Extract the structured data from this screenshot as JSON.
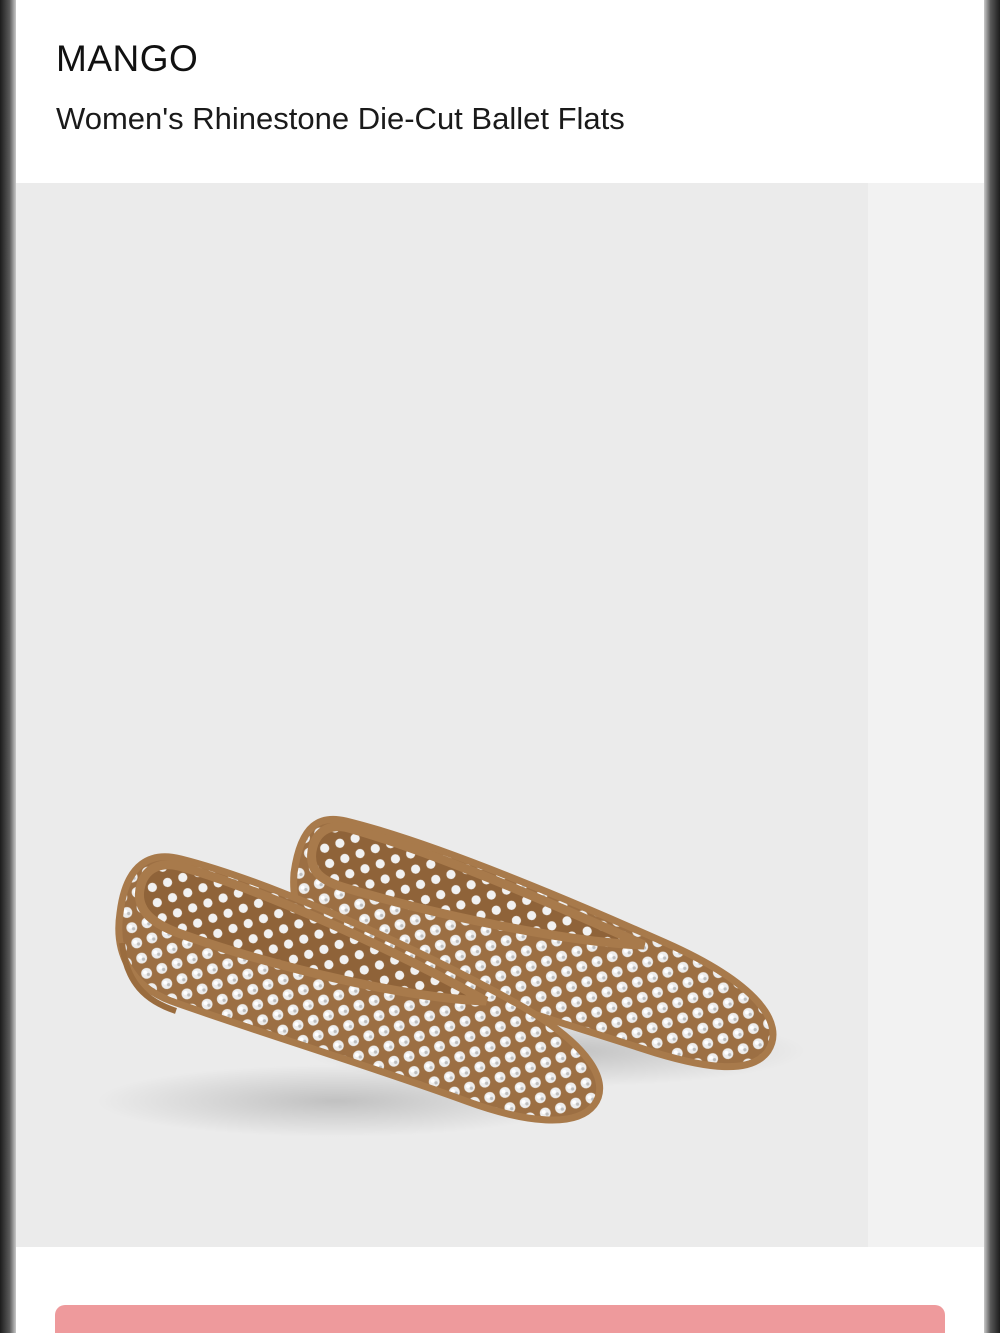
{
  "product": {
    "brand": "MANGO",
    "title": "Women's Rhinestone Die-Cut Ballet Flats"
  },
  "gallery": {
    "image_icon": "ballet-flats-photo",
    "background": "#ebebeb"
  },
  "colors": {
    "shoe_suede": "#a97b4c",
    "rhinestone": "#f4f4f4",
    "cta": "#ee9a9c"
  }
}
